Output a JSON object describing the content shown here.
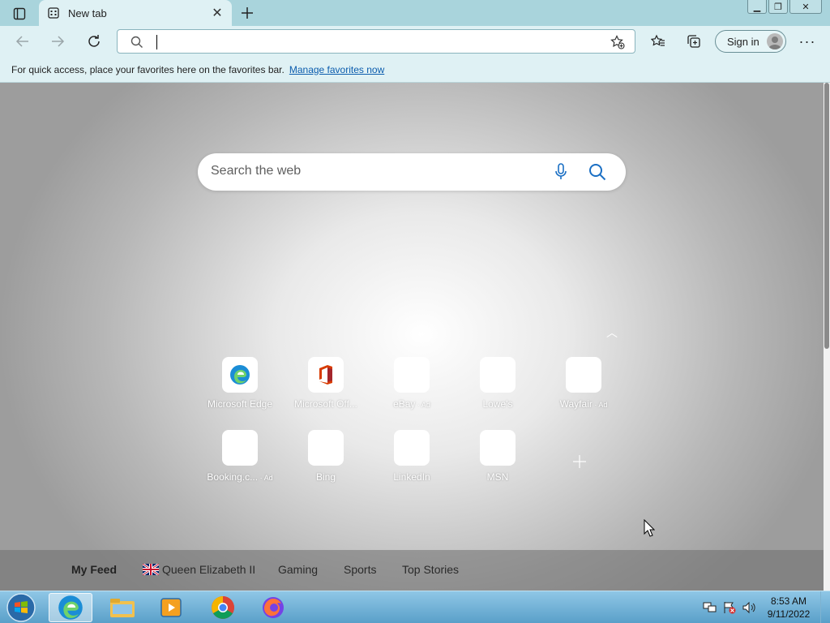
{
  "browser": {
    "tab": {
      "title": "New tab"
    },
    "address_bar": {
      "value": "",
      "placeholder": ""
    },
    "signin_label": "Sign in",
    "favorites_bar": {
      "message": "For quick access, place your favorites here on the favorites bar.",
      "link": "Manage favorites now"
    }
  },
  "newtab": {
    "search_placeholder": "Search the web",
    "tiles": [
      {
        "label": "Microsoft Edge",
        "ad": ""
      },
      {
        "label": "Microsoft Off...",
        "ad": ""
      },
      {
        "label": "eBay",
        "ad": " · Ad"
      },
      {
        "label": "Lowe's",
        "ad": ""
      },
      {
        "label": "Wayfair",
        "ad": " · Ad"
      },
      {
        "label": "Booking.c...",
        "ad": " · Ad"
      },
      {
        "label": "Bing",
        "ad": ""
      },
      {
        "label": "LinkedIn",
        "ad": ""
      },
      {
        "label": "MSN",
        "ad": ""
      }
    ],
    "feed_tabs": [
      "My Feed",
      "Queen Elizabeth II",
      "Gaming",
      "Sports",
      "Top Stories"
    ]
  },
  "taskbar": {
    "time": "8:53 AM",
    "date": "9/11/2022",
    "apps": [
      "edge-icon",
      "file-explorer-icon",
      "media-player-icon",
      "chrome-icon",
      "firefox-icon"
    ]
  },
  "colors": {
    "titlebar": "#a9d4dc",
    "toolbar": "#dff1f4",
    "link": "#0b5cad",
    "search_accent": "#1a6fc4"
  }
}
